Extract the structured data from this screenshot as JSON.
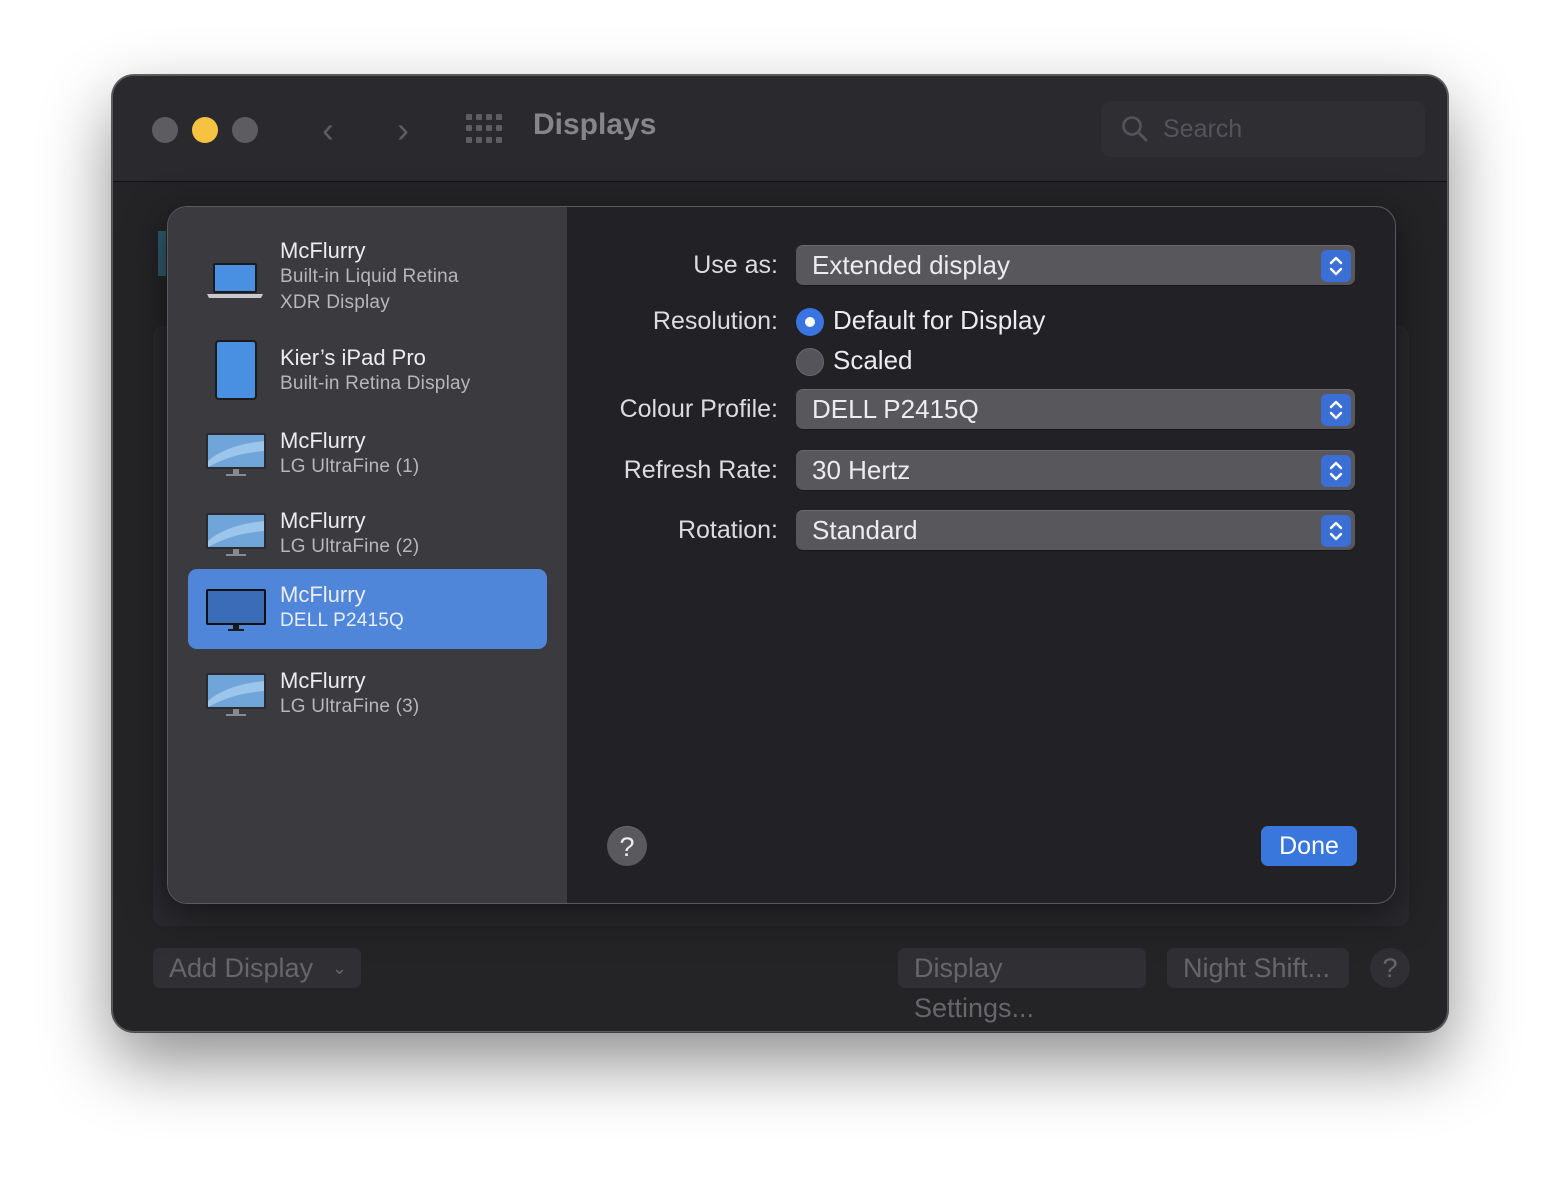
{
  "window": {
    "title": "Displays",
    "search_placeholder": "Search"
  },
  "sidebar": {
    "items": [
      {
        "name": "McFlurry",
        "sub1": "Built-in Liquid Retina",
        "sub2": "XDR Display",
        "icon": "laptop-icon",
        "selected": false
      },
      {
        "name": "Kier’s iPad Pro",
        "sub1": "Built-in Retina Display",
        "icon": "ipad-icon",
        "selected": false
      },
      {
        "name": "McFlurry",
        "sub1": "LG UltraFine (1)",
        "icon": "monitor-icon",
        "selected": false
      },
      {
        "name": "McFlurry",
        "sub1": "LG UltraFine (2)",
        "icon": "monitor-icon",
        "selected": false
      },
      {
        "name": "McFlurry",
        "sub1": "DELL P2415Q",
        "icon": "monitor-dark-icon",
        "selected": true
      },
      {
        "name": "McFlurry",
        "sub1": "LG UltraFine (3)",
        "icon": "monitor-icon",
        "selected": false
      }
    ]
  },
  "settings": {
    "use_as": {
      "label": "Use as:",
      "value": "Extended display"
    },
    "resolution": {
      "label": "Resolution:",
      "options": [
        {
          "label": "Default for Display",
          "selected": true
        },
        {
          "label": "Scaled",
          "selected": false
        }
      ]
    },
    "colour_profile": {
      "label": "Colour Profile:",
      "value": "DELL P2415Q"
    },
    "refresh_rate": {
      "label": "Refresh Rate:",
      "value": "30 Hertz"
    },
    "rotation": {
      "label": "Rotation:",
      "value": "Standard"
    },
    "help": "?",
    "done": "Done"
  },
  "bottom_bar": {
    "add_display": "Add Display",
    "display_settings": "Display Settings...",
    "night_shift": "Night Shift...",
    "help": "?"
  },
  "colors": {
    "accent": "#3a77dc",
    "selection": "#4f86d9",
    "traffic_minimize": "#f6c241"
  }
}
